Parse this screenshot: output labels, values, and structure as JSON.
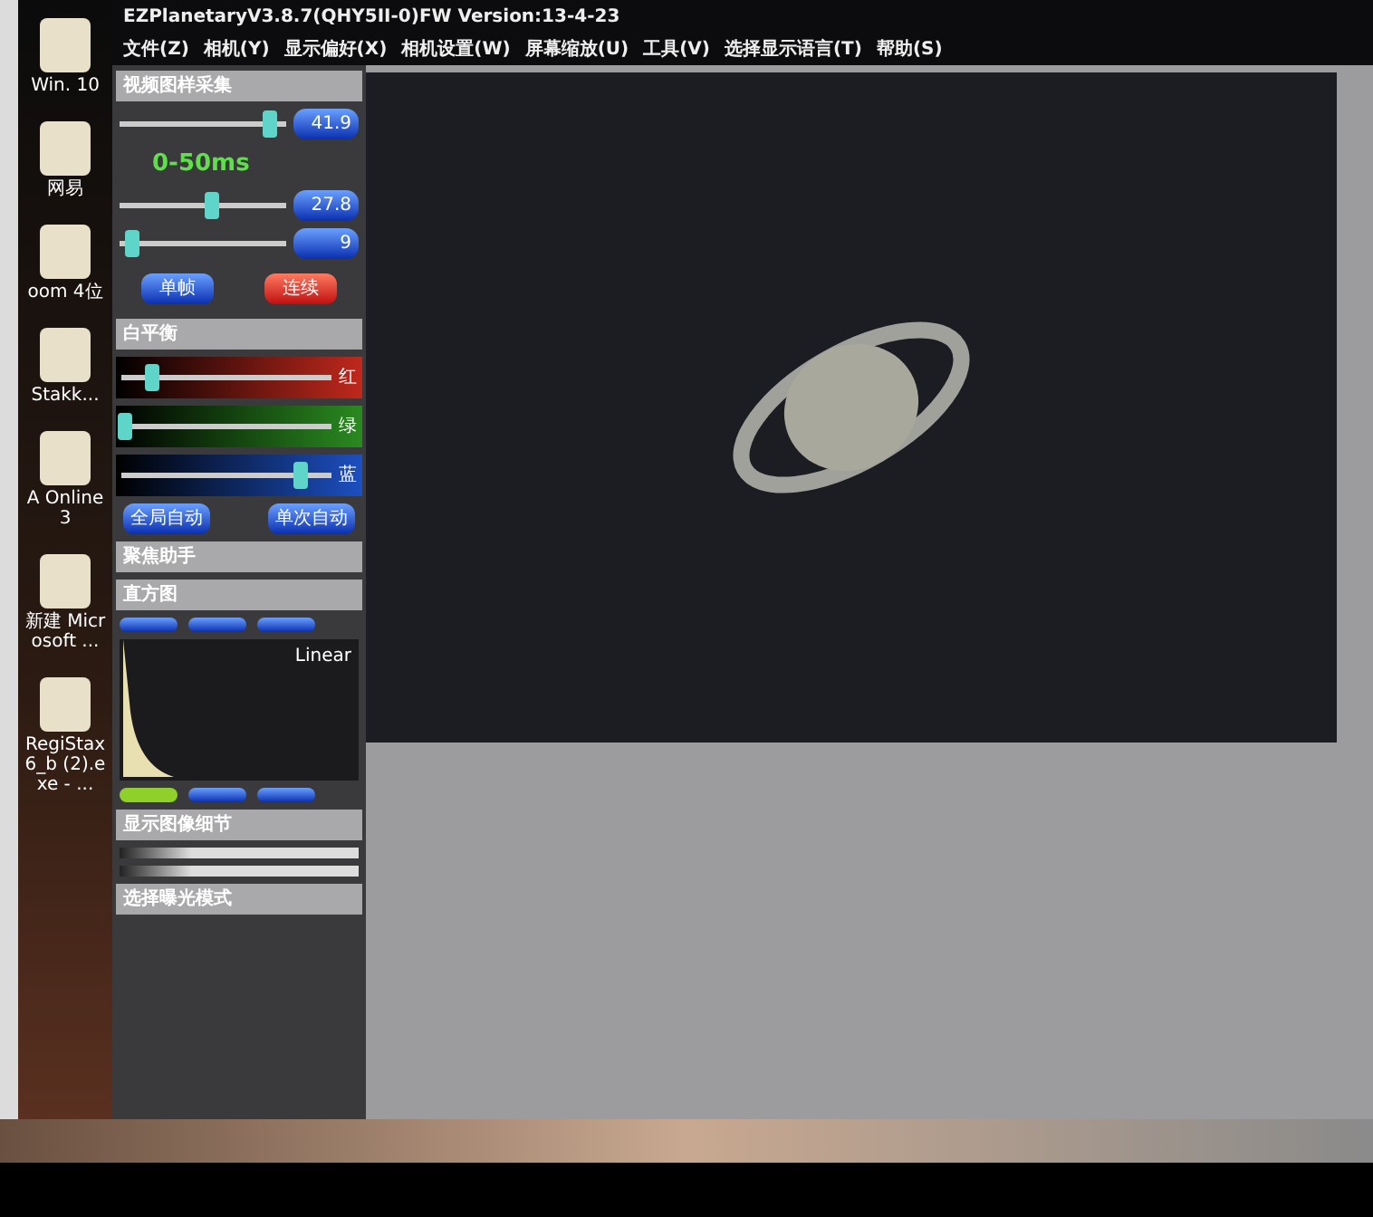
{
  "window": {
    "title": "EZPlanetaryV3.8.7(QHY5II-0)FW Version:13-4-23"
  },
  "desktop_icons": [
    {
      "label": "Win. 10"
    },
    {
      "label": "网易"
    },
    {
      "label": "oom 4位"
    },
    {
      "label": "Stakk..."
    },
    {
      "label": "A Online 3"
    },
    {
      "label": "新建 Microsoft ..."
    },
    {
      "label": "RegiStax6_b (2).exe - ..."
    }
  ],
  "menu": [
    "文件(Z)",
    "相机(Y)",
    "显示偏好(X)",
    "相机设置(W)",
    "屏幕缩放(U)",
    "工具(V)",
    "选择显示语言(T)",
    "帮助(S)"
  ],
  "capture_panel": {
    "title": "视频图样采集",
    "exposure_range": "0-50ms",
    "sliders": [
      {
        "level": 0.9,
        "value": "41.9"
      },
      {
        "level": 0.55,
        "value": "27.8"
      },
      {
        "level": 0.08,
        "value": "9"
      }
    ],
    "buttons": [
      {
        "label": "单帧",
        "kind": "primary"
      },
      {
        "label": "连续",
        "kind": "danger"
      }
    ]
  },
  "white_balance": {
    "title": "白平衡",
    "channels": [
      {
        "label": "红",
        "level": 0.15,
        "color": "#c0281c"
      },
      {
        "label": "绿",
        "level": 0.02,
        "color": "#2a8a20"
      },
      {
        "label": "蓝",
        "level": 0.85,
        "color": "#1c4fc0"
      }
    ],
    "buttons": [
      "全局自动",
      "单次自动"
    ]
  },
  "focus_panel": {
    "title": "聚焦助手"
  },
  "histogram": {
    "title": "直方图",
    "mode": "Linear"
  },
  "detail_panel": {
    "title": "显示图像细节"
  },
  "exposure_mode": {
    "label": "选择曝光模式"
  }
}
